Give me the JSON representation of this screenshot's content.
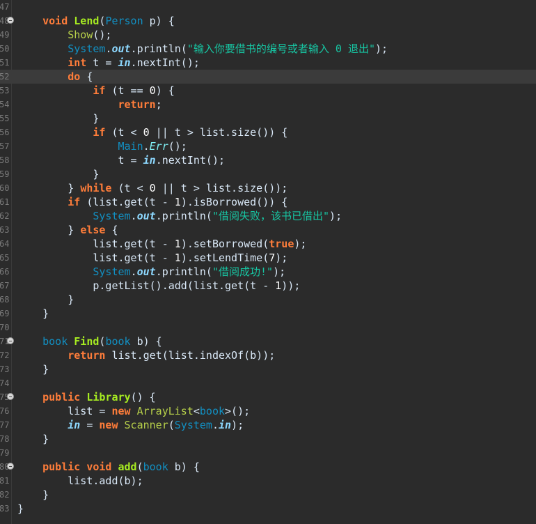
{
  "editor": {
    "lines": [
      {
        "num": "47",
        "fold": false,
        "current": false,
        "tokens": []
      },
      {
        "num": "48",
        "fold": true,
        "current": false,
        "tokens": [
          {
            "t": "    "
          },
          {
            "t": "void",
            "c": "kw"
          },
          {
            "t": " "
          },
          {
            "t": "Lend",
            "c": "fnb"
          },
          {
            "t": "("
          },
          {
            "t": "Person",
            "c": "ty"
          },
          {
            "t": " p) {"
          }
        ]
      },
      {
        "num": "49",
        "fold": false,
        "current": false,
        "tokens": [
          {
            "t": "        "
          },
          {
            "t": "Show",
            "c": "fn"
          },
          {
            "t": "();"
          }
        ]
      },
      {
        "num": "50",
        "fold": false,
        "current": false,
        "tokens": [
          {
            "t": "        "
          },
          {
            "t": "System",
            "c": "cls"
          },
          {
            "t": "."
          },
          {
            "t": "out",
            "c": "fld"
          },
          {
            "t": "."
          },
          {
            "t": "println",
            "c": "txt"
          },
          {
            "t": "("
          },
          {
            "t": "\"输入你要借书的编号或者输入 0 退出\"",
            "c": "str"
          },
          {
            "t": ");"
          }
        ]
      },
      {
        "num": "51",
        "fold": false,
        "current": false,
        "tokens": [
          {
            "t": "        "
          },
          {
            "t": "int",
            "c": "kw"
          },
          {
            "t": " t = "
          },
          {
            "t": "in",
            "c": "fld"
          },
          {
            "t": ".nextInt();"
          }
        ]
      },
      {
        "num": "52",
        "fold": false,
        "current": true,
        "tokens": [
          {
            "t": "        "
          },
          {
            "t": "do",
            "c": "kw"
          },
          {
            "t": " {"
          }
        ]
      },
      {
        "num": "53",
        "fold": false,
        "current": false,
        "tokens": [
          {
            "t": "            "
          },
          {
            "t": "if",
            "c": "kw"
          },
          {
            "t": " (t == "
          },
          {
            "t": "0",
            "c": "num"
          },
          {
            "t": ") {"
          }
        ]
      },
      {
        "num": "54",
        "fold": false,
        "current": false,
        "tokens": [
          {
            "t": "                "
          },
          {
            "t": "return",
            "c": "kw"
          },
          {
            "t": ";"
          }
        ]
      },
      {
        "num": "55",
        "fold": false,
        "current": false,
        "tokens": [
          {
            "t": "            }"
          }
        ]
      },
      {
        "num": "56",
        "fold": false,
        "current": false,
        "tokens": [
          {
            "t": "            "
          },
          {
            "t": "if",
            "c": "kw"
          },
          {
            "t": " (t < "
          },
          {
            "t": "0",
            "c": "num"
          },
          {
            "t": " || t > list.size()) {"
          }
        ]
      },
      {
        "num": "57",
        "fold": false,
        "current": false,
        "tokens": [
          {
            "t": "                "
          },
          {
            "t": "Main",
            "c": "cls"
          },
          {
            "t": "."
          },
          {
            "t": "Err",
            "c": "sfn"
          },
          {
            "t": "();"
          }
        ]
      },
      {
        "num": "58",
        "fold": false,
        "current": false,
        "tokens": [
          {
            "t": "                t = "
          },
          {
            "t": "in",
            "c": "fld"
          },
          {
            "t": ".nextInt();"
          }
        ]
      },
      {
        "num": "59",
        "fold": false,
        "current": false,
        "tokens": [
          {
            "t": "            }"
          }
        ]
      },
      {
        "num": "60",
        "fold": false,
        "current": false,
        "tokens": [
          {
            "t": "        } "
          },
          {
            "t": "while",
            "c": "kw"
          },
          {
            "t": " (t < "
          },
          {
            "t": "0",
            "c": "num"
          },
          {
            "t": " || t > list.size());"
          }
        ]
      },
      {
        "num": "61",
        "fold": false,
        "current": false,
        "tokens": [
          {
            "t": "        "
          },
          {
            "t": "if",
            "c": "kw"
          },
          {
            "t": " (list.get(t - "
          },
          {
            "t": "1",
            "c": "num"
          },
          {
            "t": ").isBorrowed()) {"
          }
        ]
      },
      {
        "num": "62",
        "fold": false,
        "current": false,
        "tokens": [
          {
            "t": "            "
          },
          {
            "t": "System",
            "c": "cls"
          },
          {
            "t": "."
          },
          {
            "t": "out",
            "c": "fld"
          },
          {
            "t": ".println("
          },
          {
            "t": "\"借阅失败，该书已借出\"",
            "c": "str"
          },
          {
            "t": ");"
          }
        ]
      },
      {
        "num": "63",
        "fold": false,
        "current": false,
        "tokens": [
          {
            "t": "        } "
          },
          {
            "t": "else",
            "c": "kw"
          },
          {
            "t": " {"
          }
        ]
      },
      {
        "num": "64",
        "fold": false,
        "current": false,
        "tokens": [
          {
            "t": "            list.get(t - "
          },
          {
            "t": "1",
            "c": "num"
          },
          {
            "t": ").setBorrowed("
          },
          {
            "t": "true",
            "c": "kw"
          },
          {
            "t": ");"
          }
        ]
      },
      {
        "num": "65",
        "fold": false,
        "current": false,
        "tokens": [
          {
            "t": "            list.get(t - "
          },
          {
            "t": "1",
            "c": "num"
          },
          {
            "t": ").setLendTime("
          },
          {
            "t": "7",
            "c": "num"
          },
          {
            "t": ");"
          }
        ]
      },
      {
        "num": "66",
        "fold": false,
        "current": false,
        "tokens": [
          {
            "t": "            "
          },
          {
            "t": "System",
            "c": "cls"
          },
          {
            "t": "."
          },
          {
            "t": "out",
            "c": "fld"
          },
          {
            "t": ".println("
          },
          {
            "t": "\"借阅成功!\"",
            "c": "str"
          },
          {
            "t": ");"
          }
        ]
      },
      {
        "num": "67",
        "fold": false,
        "current": false,
        "tokens": [
          {
            "t": "            p.getList().add(list.get(t - "
          },
          {
            "t": "1",
            "c": "num"
          },
          {
            "t": "));"
          }
        ]
      },
      {
        "num": "68",
        "fold": false,
        "current": false,
        "tokens": [
          {
            "t": "        }"
          }
        ]
      },
      {
        "num": "69",
        "fold": false,
        "current": false,
        "tokens": [
          {
            "t": "    }"
          }
        ]
      },
      {
        "num": "70",
        "fold": false,
        "current": false,
        "tokens": []
      },
      {
        "num": "71",
        "fold": true,
        "current": false,
        "tokens": [
          {
            "t": "    "
          },
          {
            "t": "book",
            "c": "ty"
          },
          {
            "t": " "
          },
          {
            "t": "Find",
            "c": "fnb"
          },
          {
            "t": "("
          },
          {
            "t": "book",
            "c": "ty"
          },
          {
            "t": " b) {"
          }
        ]
      },
      {
        "num": "72",
        "fold": false,
        "current": false,
        "tokens": [
          {
            "t": "        "
          },
          {
            "t": "return",
            "c": "kw"
          },
          {
            "t": " list.get(list.indexOf(b));"
          }
        ]
      },
      {
        "num": "73",
        "fold": false,
        "current": false,
        "tokens": [
          {
            "t": "    }"
          }
        ]
      },
      {
        "num": "74",
        "fold": false,
        "current": false,
        "tokens": []
      },
      {
        "num": "75",
        "fold": true,
        "current": false,
        "tokens": [
          {
            "t": "    "
          },
          {
            "t": "public",
            "c": "kw"
          },
          {
            "t": " "
          },
          {
            "t": "Library",
            "c": "fnb"
          },
          {
            "t": "() {"
          }
        ]
      },
      {
        "num": "76",
        "fold": false,
        "current": false,
        "tokens": [
          {
            "t": "        list = "
          },
          {
            "t": "new",
            "c": "kw"
          },
          {
            "t": " "
          },
          {
            "t": "ArrayList",
            "c": "fn"
          },
          {
            "t": "<"
          },
          {
            "t": "book",
            "c": "ty"
          },
          {
            "t": ">();"
          }
        ]
      },
      {
        "num": "77",
        "fold": false,
        "current": false,
        "tokens": [
          {
            "t": "        "
          },
          {
            "t": "in",
            "c": "fld"
          },
          {
            "t": " = "
          },
          {
            "t": "new",
            "c": "kw"
          },
          {
            "t": " "
          },
          {
            "t": "Scanner",
            "c": "fn"
          },
          {
            "t": "("
          },
          {
            "t": "System",
            "c": "cls"
          },
          {
            "t": "."
          },
          {
            "t": "in",
            "c": "fld"
          },
          {
            "t": ");"
          }
        ]
      },
      {
        "num": "78",
        "fold": false,
        "current": false,
        "tokens": [
          {
            "t": "    }"
          }
        ]
      },
      {
        "num": "79",
        "fold": false,
        "current": false,
        "tokens": []
      },
      {
        "num": "80",
        "fold": true,
        "current": false,
        "tokens": [
          {
            "t": "    "
          },
          {
            "t": "public",
            "c": "kw"
          },
          {
            "t": " "
          },
          {
            "t": "void",
            "c": "kw"
          },
          {
            "t": " "
          },
          {
            "t": "add",
            "c": "fnb"
          },
          {
            "t": "("
          },
          {
            "t": "book",
            "c": "ty"
          },
          {
            "t": " b) {"
          }
        ]
      },
      {
        "num": "81",
        "fold": false,
        "current": false,
        "tokens": [
          {
            "t": "        list.add(b);"
          }
        ]
      },
      {
        "num": "82",
        "fold": false,
        "current": false,
        "tokens": [
          {
            "t": "    }"
          }
        ]
      },
      {
        "num": "83",
        "fold": false,
        "current": false,
        "tokens": [
          {
            "t": "}"
          }
        ]
      }
    ]
  }
}
